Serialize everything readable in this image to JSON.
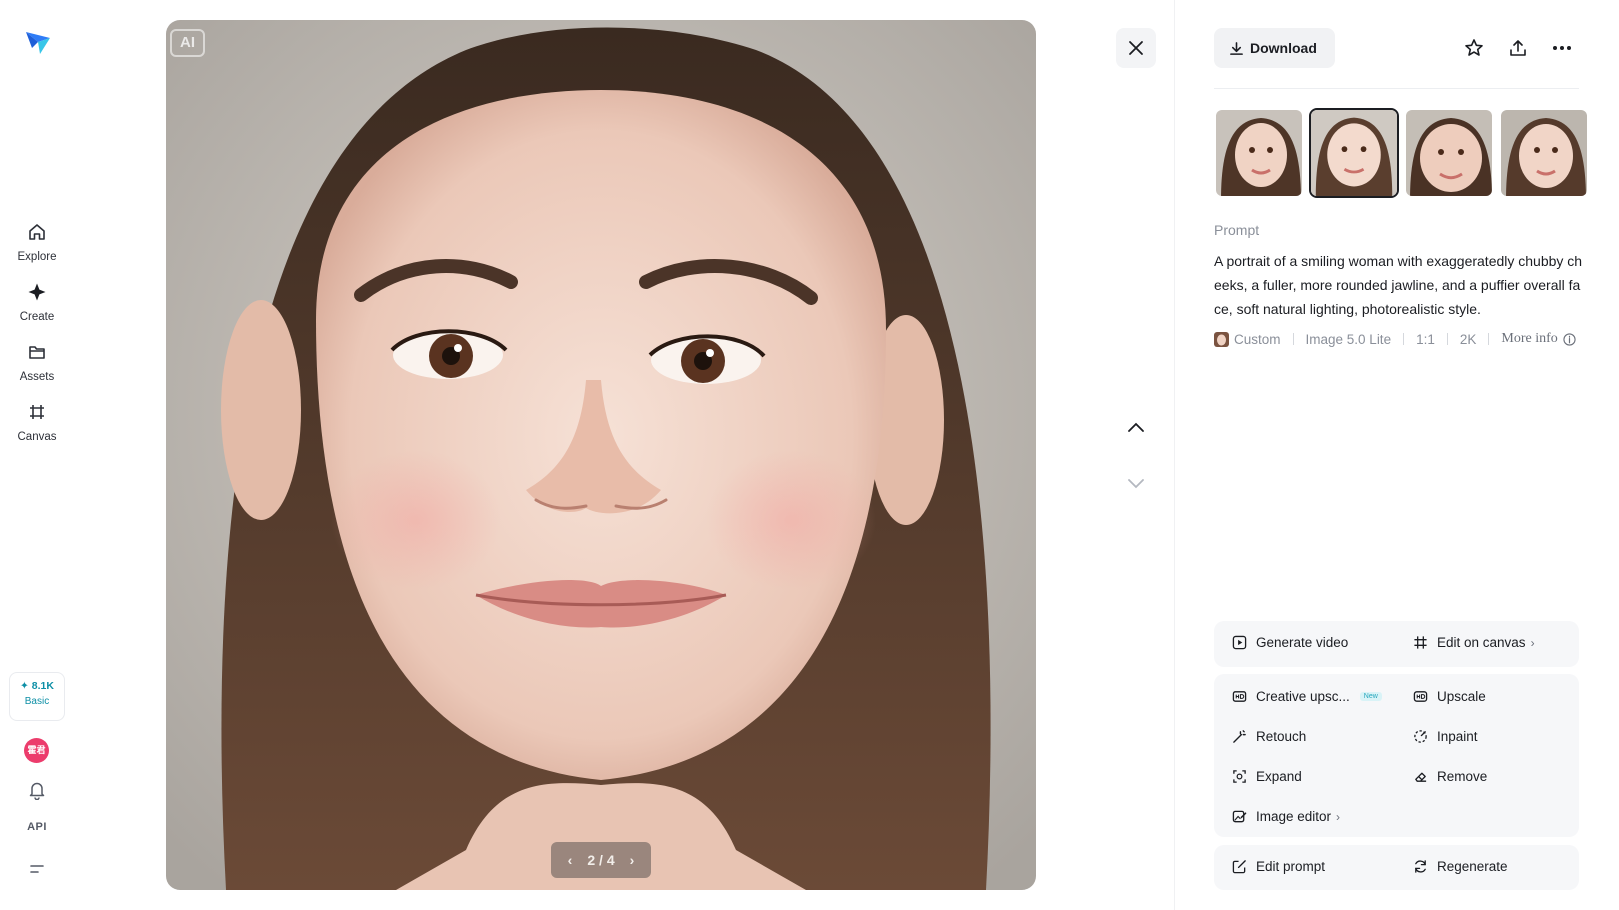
{
  "sidebar": {
    "logo_icon": "paper-plane-icon",
    "items": [
      {
        "label": "Explore",
        "icon": "home-icon"
      },
      {
        "label": "Create",
        "icon": "sparkle-icon"
      },
      {
        "label": "Assets",
        "icon": "folder-icon"
      },
      {
        "label": "Canvas",
        "icon": "canvas-frame-icon"
      }
    ],
    "credits": {
      "amount": "✦ 8.1K",
      "plan": "Basic"
    },
    "avatar_text": "霍君",
    "api_label": "API"
  },
  "viewer": {
    "badge": "AI",
    "pager": {
      "current": "2",
      "total": "4",
      "text": "2 / 4"
    }
  },
  "panel": {
    "download_label": "Download",
    "prompt_label": "Prompt",
    "prompt_text": "A portrait of a smiling woman with exaggeratedly chubby cheeks, a fuller, more rounded jawline, and a puffier overall face, soft natural lighting, photorealistic style.",
    "meta": {
      "style": "Custom",
      "model": "Image 5.0 Lite",
      "ratio": "1:1",
      "resolution": "2K",
      "more": "More info"
    },
    "thumbnails_selected_index": 1,
    "actions_primary": [
      {
        "label": "Generate video",
        "icon": "play-square-icon"
      },
      {
        "label": "Edit on canvas",
        "icon": "canvas-frame-icon"
      }
    ],
    "actions_tools": [
      {
        "label": "Creative upsc...",
        "icon": "hd-icon",
        "tag": "New"
      },
      {
        "label": "Upscale",
        "icon": "hd-box-icon"
      },
      {
        "label": "Retouch",
        "icon": "magic-wand-icon"
      },
      {
        "label": "Inpaint",
        "icon": "dashed-circle-icon"
      },
      {
        "label": "Expand",
        "icon": "expand-icon"
      },
      {
        "label": "Remove",
        "icon": "eraser-icon"
      },
      {
        "label": "Image editor",
        "icon": "image-edit-icon"
      }
    ],
    "actions_footer": [
      {
        "label": "Edit prompt",
        "icon": "edit-icon"
      },
      {
        "label": "Regenerate",
        "icon": "refresh-icon"
      }
    ]
  },
  "colors": {
    "accent": "#0d8fa6",
    "avatar": "#ec3c6c",
    "panel_card": "#f6f7f9"
  }
}
